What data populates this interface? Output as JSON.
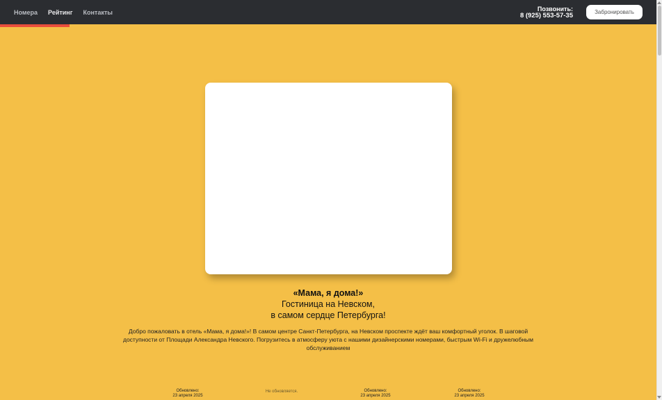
{
  "nav": {
    "items": [
      {
        "label": "Номера"
      },
      {
        "label": "Рейтинг"
      },
      {
        "label": "Контакты"
      }
    ]
  },
  "header": {
    "call_label": "Позвонить:",
    "phone": "8 (925) 553-57-35",
    "book_button": "Забронировать"
  },
  "hero": {
    "name": "«Мама, я дома!»",
    "line1": "Гостиница на Невском,",
    "line2": "в самом сердце Петербурга!",
    "description": "Добро пожаловать в отель «Мама, я дома!»! В самом центре Санкт-Петербурга, на Невском проспекте ждёт ваш комфортный уголок. В шаговой доступности от Площади Александра Невского. Погрузитесь в атмосферу уюта с нашими дизайнерскими номерами, быстрым Wi-Fi и дружелюбным обслуживанием"
  },
  "updates": [
    {
      "label": "Обновлено:",
      "date": "23 апреля 2025"
    },
    {
      "label": "Не обновляется.",
      "date": ""
    },
    {
      "label": "Обновлено:",
      "date": "23 апреля 2025"
    },
    {
      "label": "Обновлено:",
      "date": "23 апреля 2025"
    }
  ],
  "colors": {
    "background": "#f4bf47",
    "header": "#2b2d31",
    "accent": "#e94e3c"
  }
}
